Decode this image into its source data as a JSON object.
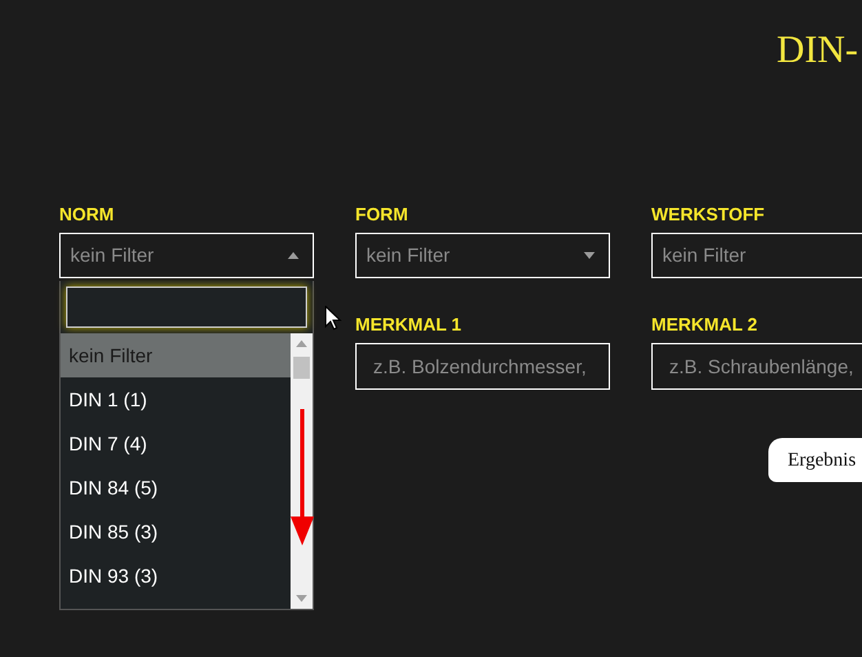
{
  "title": "DIN-",
  "filters": [
    {
      "label": "NORM",
      "value": "kein Filter",
      "kind": "select",
      "expanded": true
    },
    {
      "label": "FORM",
      "value": "kein Filter",
      "kind": "select",
      "expanded": false
    },
    {
      "label": "WERKSTOFF",
      "value": "kein Filter",
      "kind": "select"
    },
    {
      "label": "MERKMAL 1",
      "placeholder": "z.B. Bolzendurchmesser,",
      "kind": "text"
    },
    {
      "label": "MERKMAL 2",
      "placeholder": "z.B. Schraubenlänge,",
      "kind": "text"
    }
  ],
  "dropdown": {
    "options": [
      {
        "label": "kein Filter",
        "selected": true
      },
      {
        "label": "DIN 1 (1)",
        "selected": false
      },
      {
        "label": "DIN 7 (4)",
        "selected": false
      },
      {
        "label": "DIN 84 (5)",
        "selected": false
      },
      {
        "label": "DIN 85 (3)",
        "selected": false
      },
      {
        "label": "DIN 93 (3)",
        "selected": false
      }
    ]
  },
  "result_button": "Ergebnis"
}
